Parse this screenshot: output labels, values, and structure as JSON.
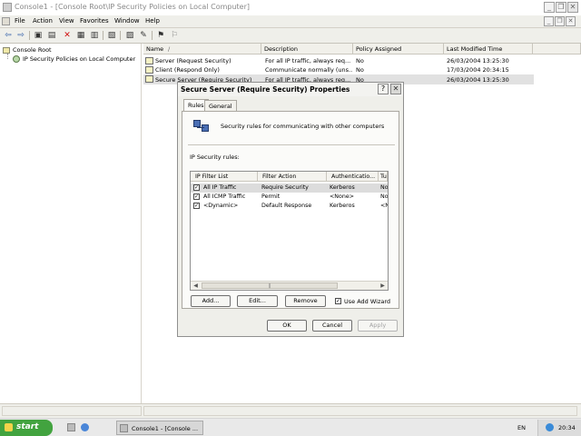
{
  "window": {
    "title": "Console1 - [Console Root\\IP Security Policies on Local Computer]",
    "controls": {
      "minimize": "_",
      "restore": "❐",
      "close": "✕"
    }
  },
  "menubar": {
    "items": [
      {
        "label": "File"
      },
      {
        "label": "Action"
      },
      {
        "label": "View"
      },
      {
        "label": "Favorites"
      },
      {
        "label": "Window"
      },
      {
        "label": "Help"
      }
    ],
    "child_controls": {
      "minimize": "_",
      "restore": "❐",
      "close": "✕"
    }
  },
  "toolbar": {
    "icons": [
      "back-icon",
      "forward-icon",
      "up-icon",
      "show-hide-tree-icon",
      "delete-icon",
      "properties-icon",
      "refresh-icon",
      "export-list-icon",
      "help-icon",
      "add-policy-icon",
      "assign-icon",
      "unassign-icon",
      "manage-filters-icon"
    ]
  },
  "tree": {
    "root": "Console Root",
    "child": "IP Security Policies on Local Computer"
  },
  "list": {
    "columns": [
      "Name",
      "Description",
      "Policy Assigned",
      "Last Modified Time"
    ],
    "sort_marker": "/",
    "rows": [
      {
        "name": "Server (Request Security)",
        "description": "For all IP traffic, always req...",
        "assigned": "No",
        "modified": "26/03/2004 13:25:30"
      },
      {
        "name": "Client (Respond Only)",
        "description": "Communicate normally (uns...",
        "assigned": "No",
        "modified": "17/03/2004 20:34:15"
      },
      {
        "name": "Secure Server (Require Security)",
        "description": "For all IP traffic, always req...",
        "assigned": "No",
        "modified": "26/03/2004 13:25:30"
      }
    ]
  },
  "dialog": {
    "title": "Secure Server (Require Security) Properties",
    "controls": {
      "help": "?",
      "close": "✕"
    },
    "tabs": [
      {
        "label": "Rules"
      },
      {
        "label": "General"
      }
    ],
    "description": "Security rules for communicating with other computers",
    "rules_label": "IP Security rules:",
    "rules_columns": [
      "IP Filter List",
      "Filter Action",
      "Authenticatio...",
      "Tu"
    ],
    "rules": [
      {
        "checked": true,
        "filter": "All IP Traffic",
        "action": "Require Security",
        "auth": "Kerberos",
        "tunnel": "No"
      },
      {
        "checked": true,
        "filter": "All ICMP Traffic",
        "action": "Permit",
        "auth": "<None>",
        "tunnel": "No"
      },
      {
        "checked": true,
        "filter": "<Dynamic>",
        "action": "Default Response",
        "auth": "Kerberos",
        "tunnel": "<N"
      }
    ],
    "scroll": {
      "left": "◀",
      "thumb": "‖",
      "right": "▶"
    },
    "buttons": {
      "add": "Add...",
      "edit": "Edit...",
      "remove": "Remove"
    },
    "wizard_checkbox": {
      "label": "Use Add Wizard",
      "checked": true
    },
    "footer": {
      "ok": "OK",
      "cancel": "Cancel",
      "apply": "Apply"
    }
  },
  "taskbar": {
    "start": "start",
    "task": "Console1 - [Console ...",
    "language": "EN",
    "clock": "20:34"
  },
  "check_glyph": "✓"
}
